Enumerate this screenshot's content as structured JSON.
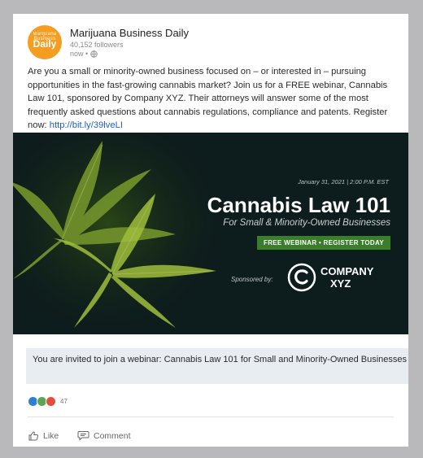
{
  "post": {
    "author": "Marijuana Business Daily",
    "followers": "40,152 followers",
    "time": "now •",
    "avatar_text": "Daily",
    "avatar_small": "Marijuana Business",
    "text_main": "Are you a small or minority-owned business focused on – or interested in – pursuing opportunities in the fast-growing cannabis market? Join us for a FREE webinar, Cannabis Law 101, sponsored by Company XYZ. Their attorneys will answer some of the most frequently asked questions about cannabis regulations, compliance and patents. Register now: ",
    "link": "http://bit.ly/39lveLI"
  },
  "banner": {
    "date": "January 31, 2021 | 2:00 P.M. EST",
    "title": "Cannabis Law 101",
    "subtitle": "For Small & Minority-Owned Businesses",
    "cta": "FREE WEBINAR • REGISTER TODAY",
    "sponsored_by": "Sponsored by:",
    "company_line1": "COMPANY",
    "company_line2": "XYZ"
  },
  "caption": "You are invited to join a webinar: Cannabis Law 101 for Small and Minority-Owned Businesses",
  "reactions": {
    "count": "47",
    "colors": [
      "#2d7fd6",
      "#5aa653",
      "#e44d3a"
    ]
  },
  "actions": {
    "like": "Like",
    "comment": "Comment"
  },
  "colors": {
    "brand_orange": "#f59d20",
    "banner_bg": "#0d1c1c",
    "cta_green": "#3a7d2b",
    "link_blue": "#1d5fbf"
  }
}
